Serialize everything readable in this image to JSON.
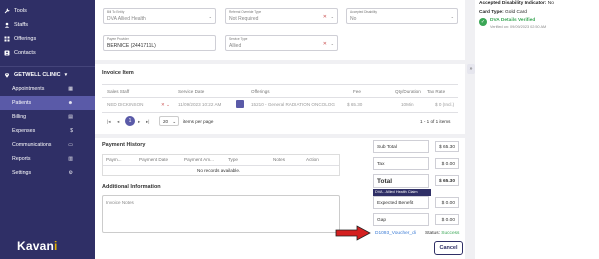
{
  "sidebar": {
    "top_items": [
      {
        "label": "Tools",
        "icon": "wrench-icon"
      },
      {
        "label": "Staffs",
        "icon": "user-icon"
      },
      {
        "label": "Offerings",
        "icon": "grid-icon"
      },
      {
        "label": "Contacts",
        "icon": "contact-icon"
      }
    ],
    "clinic_name": "GETWELL CLINIC",
    "clinic_items": [
      {
        "label": "Appointments",
        "active": false
      },
      {
        "label": "Patients",
        "active": true
      },
      {
        "label": "Billing",
        "active": false
      },
      {
        "label": "Expenses",
        "active": false
      },
      {
        "label": "Communications",
        "active": false
      },
      {
        "label": "Reports",
        "active": false
      },
      {
        "label": "Settings",
        "active": false
      }
    ],
    "brand_main": "Kavan",
    "brand_end": "i"
  },
  "form": {
    "bill_to": {
      "label": "Bill To Entity",
      "value": "DVA Allied Health"
    },
    "referral": {
      "label": "Referral Override Type",
      "value": "Not Required"
    },
    "accepted": {
      "label": "Accepted Disability",
      "value": "No"
    },
    "payee": {
      "label": "Payee Provider",
      "value": "BERNICE  (2441711L)"
    },
    "service_type": {
      "label": "Service Type",
      "value": "Allied"
    }
  },
  "invoice_item": {
    "title": "Invoice Item",
    "headers": [
      "Sales Staff",
      "Service Date",
      "Offerings",
      "Fee",
      "Qty/Duration",
      "Tax Rate"
    ],
    "row": {
      "staff": "NED DICKINSON",
      "date": "11/09/2023 10:22 AM",
      "offering": "15210 - General RADIATION ONCOLOG",
      "fee": "$ 65.30",
      "qty": "10Min",
      "tax": "$ 0 (Incl.)"
    },
    "pagination": {
      "page": "1",
      "per_page": "20",
      "per_page_label": "items per page",
      "range": "1 - 1 of 1 items"
    }
  },
  "payment_history": {
    "title": "Payment History",
    "headers": [
      "Paym...",
      "Payment Date",
      "Payment Am...",
      "Type",
      "Notes",
      "Action"
    ],
    "empty": "No records available."
  },
  "additional": {
    "title": "Additional Information",
    "placeholder": "Invoice Notes"
  },
  "totals": {
    "subtotal_label": "Sub Total",
    "subtotal": "$ 65.30",
    "tax_label": "Tax",
    "tax": "$ 0.00",
    "total_label": "Total",
    "total": "$ 65.30",
    "claim_badge": "DVA - Allied Health Claim",
    "expected_label": "Expected Benefit",
    "expected": "$ 0.00",
    "gap_label": "Gap",
    "gap": "$ 0.00"
  },
  "voucher": {
    "link": "D1093_Voucher_di",
    "status_label": "Status:",
    "status": "Success"
  },
  "cancel_label": "Cancel",
  "right": {
    "disability_label": "Accepted Disability Indicator:",
    "disability": "No",
    "card_label": "Card Type:",
    "card": "Gold Card",
    "dva_status": "DVA Details Verified",
    "verified_on": "Verified on: 09/09/2023 02:50 AM"
  },
  "colors": {
    "sidebar": "#2f2f66",
    "active": "#5a5aa8",
    "success": "#3aa655",
    "arrow": "#d42020",
    "brand_dot": "#e8b400"
  }
}
